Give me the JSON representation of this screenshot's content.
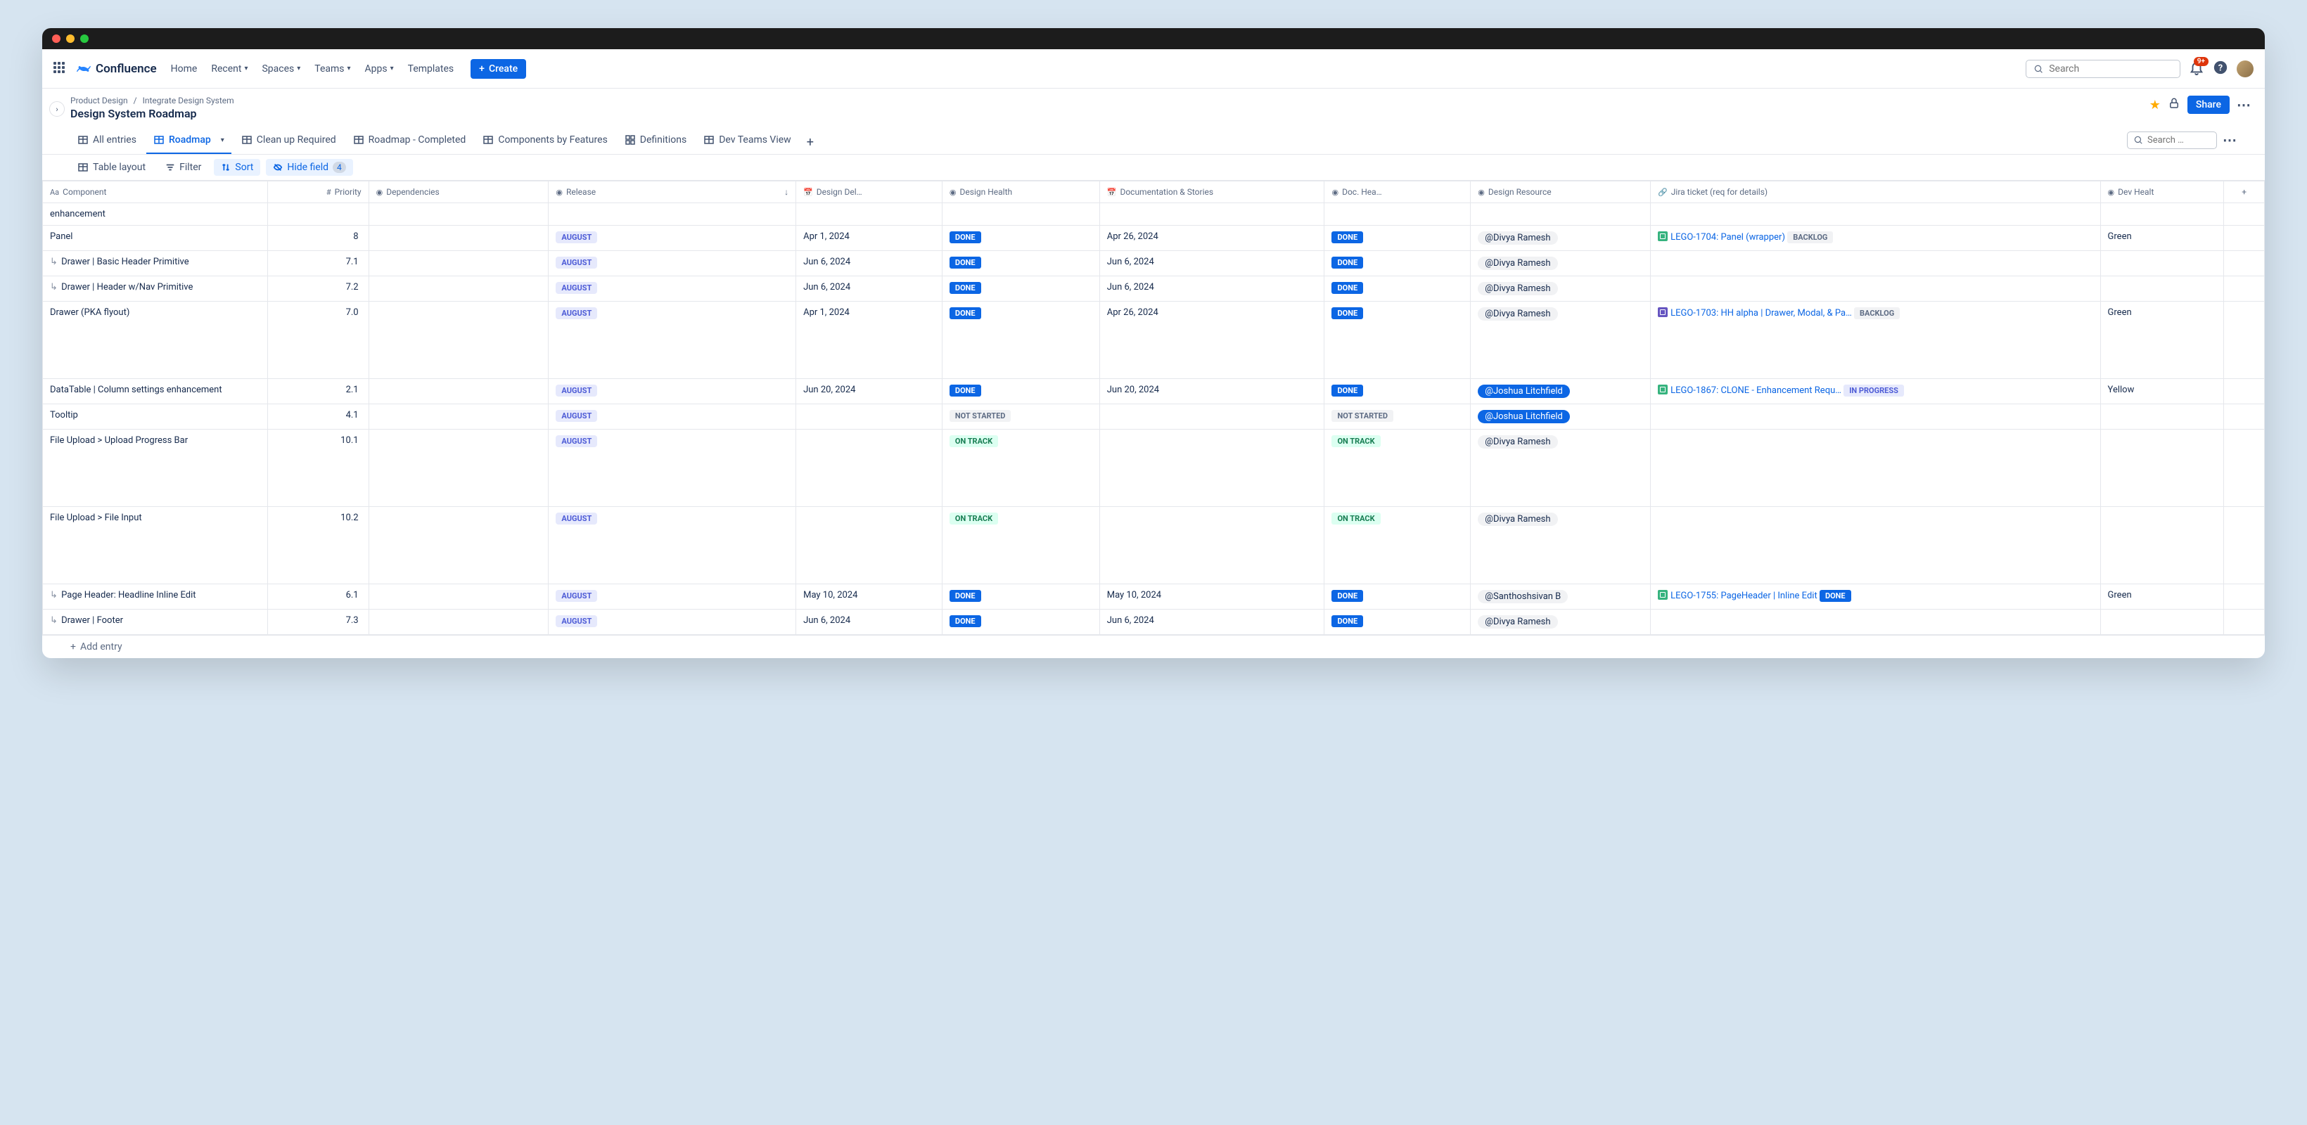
{
  "app": {
    "name": "Confluence",
    "search_placeholder": "Search",
    "notif_badge": "9+"
  },
  "nav": {
    "home": "Home",
    "recent": "Recent",
    "spaces": "Spaces",
    "teams": "Teams",
    "apps": "Apps",
    "templates": "Templates",
    "create": "Create"
  },
  "breadcrumb": {
    "a": "Product Design",
    "b": "Integrate Design System"
  },
  "page_title": "Design System Roadmap",
  "share_label": "Share",
  "views": {
    "all": "All entries",
    "roadmap": "Roadmap",
    "cleanup": "Clean up Required",
    "completed": "Roadmap - Completed",
    "components": "Components by Features",
    "definitions": "Definitions",
    "dev": "Dev Teams View",
    "search_placeholder": "Search …"
  },
  "toolbar": {
    "layout": "Table layout",
    "filter": "Filter",
    "sort": "Sort",
    "hide": "Hide field",
    "hide_count": "4"
  },
  "columns": {
    "component": "Component",
    "priority": "Priority",
    "dependencies": "Dependencies",
    "release": "Release",
    "design_del": "Design Del…",
    "design_health": "Design Health",
    "docs_stories": "Documentation & Stories",
    "doc_hea": "Doc. Hea…",
    "design_resource": "Design Resource",
    "jira": "Jira ticket (req for details)",
    "dev_health": "Dev Healt"
  },
  "rows": [
    {
      "component": "enhancement",
      "indent": false,
      "priority": "",
      "release": "",
      "design_del": "",
      "design_health": "",
      "docs_stories": "",
      "doc_hea": "",
      "resource": "",
      "resource_style": "",
      "jira_text": "",
      "jira_status": "",
      "dev_health": ""
    },
    {
      "component": "Panel",
      "indent": false,
      "priority": "8",
      "release": "AUGUST",
      "design_del": "Apr 1, 2024",
      "design_health": "DONE",
      "docs_stories": "Apr 26, 2024",
      "doc_hea": "DONE",
      "resource": "@Divya Ramesh",
      "resource_style": "grey",
      "jira_icon": "green",
      "jira_text": "LEGO-1704: Panel (wrapper)",
      "jira_status": "BACKLOG",
      "dev_health": "Green"
    },
    {
      "component": "Drawer | Basic Header Primitive",
      "indent": true,
      "priority": "7.1",
      "release": "AUGUST",
      "design_del": "Jun 6, 2024",
      "design_health": "DONE",
      "docs_stories": "Jun 6, 2024",
      "doc_hea": "DONE",
      "resource": "@Divya Ramesh",
      "resource_style": "grey",
      "jira_text": "",
      "jira_status": "",
      "dev_health": ""
    },
    {
      "component": "Drawer | Header w/Nav Primitive",
      "indent": true,
      "priority": "7.2",
      "release": "AUGUST",
      "design_del": "Jun 6, 2024",
      "design_health": "DONE",
      "docs_stories": "Jun 6, 2024",
      "doc_hea": "DONE",
      "resource": "@Divya Ramesh",
      "resource_style": "grey",
      "jira_text": "",
      "jira_status": "",
      "dev_health": ""
    },
    {
      "component": "Drawer (PKA flyout)",
      "indent": false,
      "priority": "7.0",
      "release": "AUGUST",
      "design_del": "Apr 1, 2024",
      "design_health": "DONE",
      "docs_stories": "Apr 26, 2024",
      "doc_hea": "DONE",
      "resource": "@Divya Ramesh",
      "resource_style": "grey",
      "jira_icon": "purple",
      "jira_text": "LEGO-1703: HH alpha | Drawer, Modal, & Pa…",
      "jira_status": "BACKLOG",
      "dev_health": "Green",
      "tall": true
    },
    {
      "component": "DataTable | Column settings enhancement",
      "indent": false,
      "priority": "2.1",
      "release": "AUGUST",
      "design_del": "Jun 20, 2024",
      "design_health": "DONE",
      "docs_stories": "Jun 20, 2024",
      "doc_hea": "DONE",
      "resource": "@Joshua Litchfield",
      "resource_style": "blue",
      "jira_icon": "green",
      "jira_text": "LEGO-1867: CLONE - Enhancement Requ…",
      "jira_status": "IN PROGRESS",
      "dev_health": "Yellow"
    },
    {
      "component": "Tooltip",
      "indent": false,
      "priority": "4.1",
      "release": "AUGUST",
      "design_del": "",
      "design_health": "NOT STARTED",
      "docs_stories": "",
      "doc_hea": "NOT STARTED",
      "resource": "@Joshua Litchfield",
      "resource_style": "blue",
      "jira_text": "",
      "jira_status": "",
      "dev_health": ""
    },
    {
      "component": "File Upload > Upload Progress Bar",
      "indent": false,
      "priority": "10.1",
      "release": "AUGUST",
      "design_del": "",
      "design_health": "ON TRACK",
      "docs_stories": "",
      "doc_hea": "ON TRACK",
      "resource": "@Divya Ramesh",
      "resource_style": "grey",
      "jira_text": "",
      "jira_status": "",
      "dev_health": "",
      "tall": true
    },
    {
      "component": "File Upload > File Input",
      "indent": false,
      "priority": "10.2",
      "release": "AUGUST",
      "design_del": "",
      "design_health": "ON TRACK",
      "docs_stories": "",
      "doc_hea": "ON TRACK",
      "resource": "@Divya Ramesh",
      "resource_style": "grey",
      "jira_text": "",
      "jira_status": "",
      "dev_health": "",
      "tall": true
    },
    {
      "component": "Page Header: Headline Inline Edit",
      "indent": true,
      "priority": "6.1",
      "release": "AUGUST",
      "design_del": "May 10, 2024",
      "design_health": "DONE",
      "docs_stories": "May 10, 2024",
      "doc_hea": "DONE",
      "resource": "@Santhoshsivan B",
      "resource_style": "grey",
      "jira_icon": "green",
      "jira_text": "LEGO-1755: PageHeader | Inline Edit",
      "jira_status": "DONE",
      "dev_health": "Green"
    },
    {
      "component": "Drawer | Footer",
      "indent": true,
      "priority": "7.3",
      "release": "AUGUST",
      "design_del": "Jun 6, 2024",
      "design_health": "DONE",
      "docs_stories": "Jun 6, 2024",
      "doc_hea": "DONE",
      "resource": "@Divya Ramesh",
      "resource_style": "grey",
      "jira_text": "",
      "jira_status": "",
      "dev_health": "",
      "cut": true
    }
  ],
  "footer_add": "Add entry"
}
